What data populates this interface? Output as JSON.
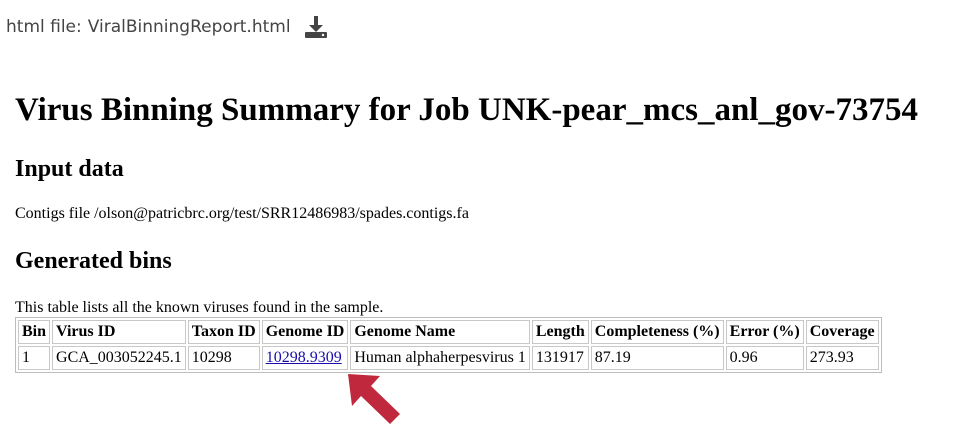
{
  "file_bar": {
    "label": "html file:",
    "filename": "ViralBinningReport.html"
  },
  "report": {
    "title": "Virus Binning Summary for Job UNK-pear_mcs_anl_gov-73754",
    "input_heading": "Input data",
    "contigs_text": "Contigs file /olson@patricbrc.org/test/SRR12486983/spades.contigs.fa",
    "bins_heading": "Generated bins",
    "table_description": "This table lists all the known viruses found in the sample."
  },
  "table": {
    "headers": [
      "Bin",
      "Virus ID",
      "Taxon ID",
      "Genome ID",
      "Genome Name",
      "Length",
      "Completeness (%)",
      "Error (%)",
      "Coverage"
    ],
    "rows": [
      [
        "1",
        "GCA_003052245.1",
        "10298",
        "10298.9309",
        "Human alphaherpesvirus 1",
        "131917",
        "87.19",
        "0.96",
        "273.93"
      ]
    ]
  },
  "colors": {
    "arrow": "#c0283d",
    "link": "#1a0dab"
  },
  "icons": {
    "download": "download-icon",
    "pointer": "arrow-pointer-icon"
  }
}
